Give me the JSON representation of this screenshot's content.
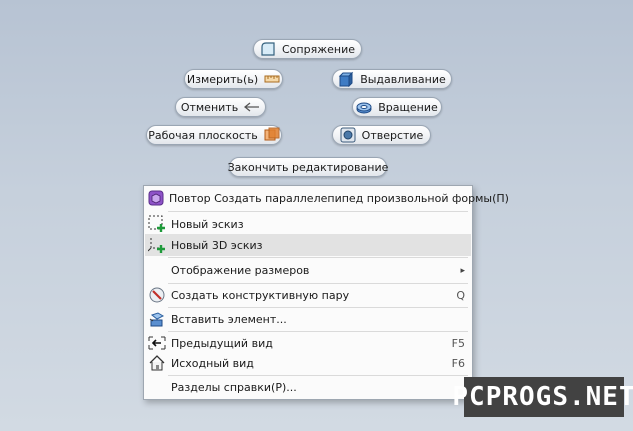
{
  "marking_menu": {
    "fillet": "Сопряжение",
    "measure": "Измерить(ь)",
    "extrude": "Выдавливание",
    "undo": "Отменить",
    "revolve": "Вращение",
    "work_plane": "Рабочая плоскость",
    "hole": "Отверстие",
    "finish_edit": "Закончить редактирование"
  },
  "context_menu": {
    "items": [
      {
        "label": "Повтор Создать параллелепипед произвольной формы(П)",
        "shortcut": "",
        "icon": "freeform-box-icon"
      },
      {
        "label": "Новый эскиз",
        "shortcut": "",
        "icon": "new-sketch-icon"
      },
      {
        "label": "Новый 3D эскиз",
        "shortcut": "",
        "icon": "new-3d-sketch-icon"
      },
      {
        "label": "Отображение размеров",
        "shortcut": "▸",
        "icon": ""
      },
      {
        "label": "Создать конструктивную пару",
        "shortcut": "Q",
        "icon": "constraint-pair-icon"
      },
      {
        "label": "Вставить элемент...",
        "shortcut": "",
        "icon": "insert-element-icon"
      },
      {
        "label": "Предыдущий вид",
        "shortcut": "F5",
        "icon": "previous-view-icon"
      },
      {
        "label": "Исходный вид",
        "shortcut": "F6",
        "icon": "home-view-icon"
      },
      {
        "label": "Разделы справки(Р)...",
        "shortcut": "",
        "icon": ""
      }
    ],
    "highlighted_index": 2
  },
  "watermark": "PCPROGS.NET"
}
